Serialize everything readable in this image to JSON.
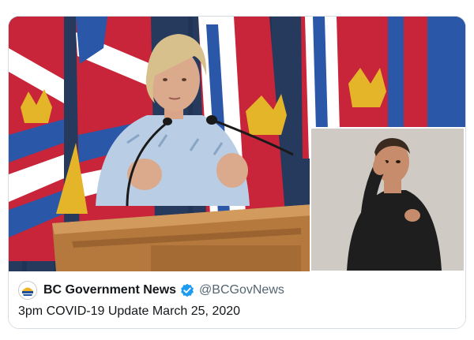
{
  "card": {
    "source_name": "BC Government News",
    "handle": "@BCGovNews",
    "caption": "3pm COVID-19 Update March 25, 2020",
    "logo_icon": "bc-government-logo-icon",
    "verified_icon": "verified-badge-icon"
  },
  "colors": {
    "verified_blue": "#1d9bf0",
    "text_primary": "#14171a",
    "text_secondary": "#536471"
  }
}
